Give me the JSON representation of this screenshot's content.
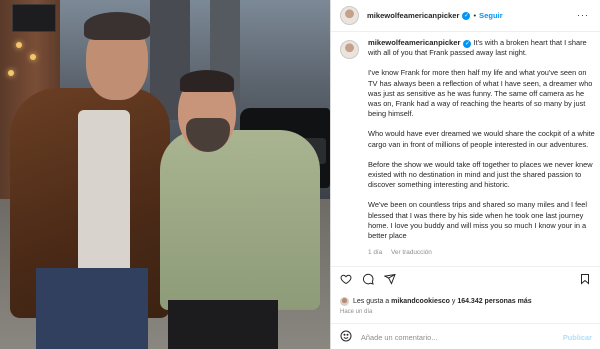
{
  "header": {
    "username": "mikewolfeamericanpicker",
    "follow_label": "Seguir",
    "dot": "•",
    "more": "···"
  },
  "caption": {
    "username": "mikewolfeamericanpicker",
    "paragraphs": [
      "It's with a broken heart that I share with all of you that Frank passed away last night.",
      "I've know Frank for more then half my life and what you've seen on TV has always been a reflection of what I have seen, a dreamer who was just as sensitive as he was funny. The same off camera as he was on, Frank had a way of reaching the hearts of so many by just being himself.",
      "Who would have ever dreamed we would share the cockpit of a white cargo van in front of millions of people interested in our adventures.",
      "Before the show we would take off together to places we never knew existed with no destination in mind and just the shared passion to discover something interesting and historic.",
      "We've been on countless trips and shared so many miles and I feel blessed that I was there by his side when he took one last journey home. I love you buddy and will miss you so much I know your in a better place"
    ],
    "time": "1 día",
    "translate": "Ver traducción"
  },
  "likes": {
    "prefix": "Les gusta a",
    "user": "mikandcookiesco",
    "connector": "y",
    "count": "164.342 personas más"
  },
  "post_time": "Hace un día",
  "comment": {
    "placeholder": "Añade un comentario...",
    "post_label": "Publicar"
  },
  "icons": [
    "heart-icon",
    "comment-icon",
    "share-icon",
    "bookmark-icon",
    "emoji-icon",
    "verified-badge-icon"
  ],
  "colors": {
    "link": "#0095f6",
    "muted": "#8e8e8e",
    "post_disabled": "#b2dffc"
  }
}
